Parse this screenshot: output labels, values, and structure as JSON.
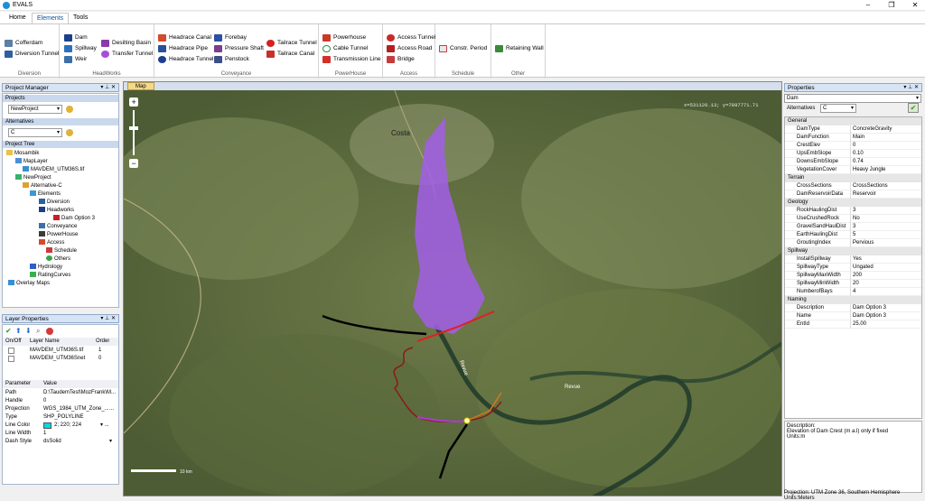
{
  "app": {
    "title": "EVALS"
  },
  "menu": {
    "items": [
      {
        "label": "Home"
      },
      {
        "label": "Elements"
      },
      {
        "label": "Tools"
      }
    ]
  },
  "ribbon": {
    "groups": [
      {
        "label": "Diversion",
        "buttons": [
          "Cofferdam",
          "Diversion Tunnel"
        ]
      },
      {
        "label": "HeadWorks",
        "buttons": [
          "Dam",
          "Spillway",
          "Weir",
          "Desilting Basin",
          "Transfer Tunnel"
        ]
      },
      {
        "label": "Conveyance",
        "buttons": [
          "Headrace Canal",
          "Headrace Pipe",
          "Headrace Tunnel",
          "Forebay",
          "Pressure Shaft",
          "Penstock",
          "Tailrace Tunnel",
          "Tailrace Canal"
        ]
      },
      {
        "label": "PowerHouse",
        "buttons": [
          "Powerhouse",
          "Cable Tunnel",
          "Transmission Line"
        ]
      },
      {
        "label": "Access",
        "buttons": [
          "Access Tunnel",
          "Access Road",
          "Bridge"
        ]
      },
      {
        "label": "Schedule",
        "buttons": [
          "Constr. Period"
        ]
      },
      {
        "label": "Other",
        "buttons": [
          "Retaining Wall"
        ]
      }
    ]
  },
  "project_manager": {
    "title": "Project Manager",
    "projects_label": "Projects",
    "project_value": "NewProject",
    "alternatives_label": "Alternatives",
    "alternative_value": "C",
    "tree_label": "Project Tree",
    "tree": [
      "Mosambik",
      "MapLayer",
      "MAVDEM_UTM36S.tif",
      "NewProject",
      "Alternative-C",
      "Elements",
      "Diversion",
      "Headworks",
      "Dam Option 3",
      "Conveyance",
      "PowerHouse",
      "Access",
      "Schedule",
      "Others",
      "Hydrology",
      "RatingCurves",
      "Overlay Maps"
    ]
  },
  "layer_properties": {
    "title": "Layer Properties",
    "columns": [
      "On/Off",
      "Layer Name",
      "Order"
    ],
    "rows": [
      {
        "name": "MAVDEM_UTM36S.tif",
        "order": "1"
      },
      {
        "name": "MAVDEM_UTM36Snet",
        "order": "0"
      }
    ],
    "param_columns": [
      "Parameter",
      "Value"
    ],
    "params": [
      {
        "k": "Path",
        "v": "D:\\TaudemTest\\MozFrank\\M..."
      },
      {
        "k": "Handle",
        "v": "0"
      },
      {
        "k": "Projection",
        "v": "WGS_1984_UTM_Zone_..."
      },
      {
        "k": "Type",
        "v": "SHP_POLYLINE"
      },
      {
        "k": "Line Color",
        "v": "2; 220; 224"
      },
      {
        "k": "Line Width",
        "v": "1"
      },
      {
        "k": "Dash Style",
        "v": "dsSolid"
      }
    ],
    "line_color": "#02dce0"
  },
  "map": {
    "tab_label": "Map",
    "coords": "x=531120.13; y=7897771.71",
    "labels": {
      "town": "Costa",
      "river1": "Revue",
      "river2": "Revue"
    },
    "scale_label": "10 km"
  },
  "properties": {
    "title": "Properties",
    "object": "Dam",
    "alternatives_label": "Alternatives",
    "alternative_value": "C",
    "sections": [
      {
        "name": "General",
        "rows": [
          [
            "DamType",
            "ConcreteGravity"
          ],
          [
            "DamFunction",
            "Main"
          ],
          [
            "CrestElev",
            "0"
          ],
          [
            "UpsEmbSlope",
            "0.10"
          ],
          [
            "DownsEmbSlope",
            "0.74"
          ],
          [
            "VegetationCover",
            "Heavy Jungle"
          ]
        ]
      },
      {
        "name": "Terrain",
        "rows": [
          [
            "CrossSections",
            "CrossSections"
          ],
          [
            "DamReservoirData",
            "Reservoir"
          ]
        ]
      },
      {
        "name": "Geology",
        "rows": [
          [
            "RockHaulingDist",
            "3"
          ],
          [
            "UseCrushedRock",
            "No"
          ],
          [
            "GravelSandHaulDist",
            "3"
          ],
          [
            "EarthHaulingDist",
            "5"
          ],
          [
            "GroutingIndex",
            "Pervious"
          ]
        ]
      },
      {
        "name": "Spillway",
        "rows": [
          [
            "InstallSpillway",
            "Yes"
          ],
          [
            "SpillwayType",
            "Ungated"
          ],
          [
            "SpillwayMaxWidth",
            "200"
          ],
          [
            "SpillwayMinWidth",
            "20"
          ],
          [
            "NumberofBays",
            "4"
          ]
        ]
      },
      {
        "name": "Naming",
        "rows": [
          [
            "Description",
            "Dam Option 3"
          ],
          [
            "Name",
            "Dam Option 3"
          ],
          [
            "EntId",
            "25.00"
          ]
        ]
      }
    ],
    "description_label": "Description:",
    "description_text": "Elevation of Dam Crest (m a.l) only if fixed",
    "description_units": "Units:m"
  },
  "status": {
    "text": "Projection: UTM Zone 36, Southern Hemisphere Units:Meters"
  }
}
